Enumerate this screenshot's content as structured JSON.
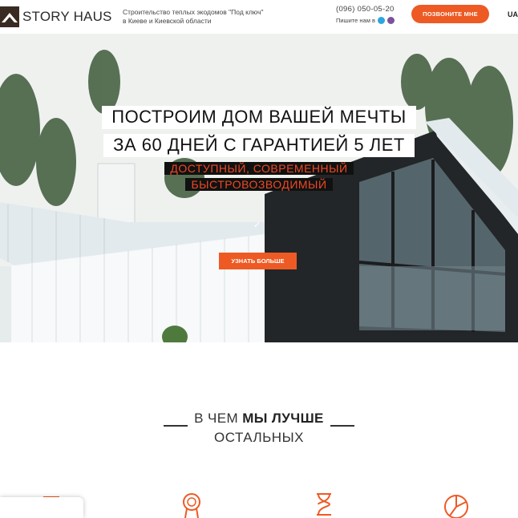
{
  "header": {
    "logo_text": "STORY HAUS",
    "tagline_line1": "Строительство теплых экодомов \"Под ключ\"",
    "tagline_line2": "в Киеве и Киевской области",
    "phone": "(096) 050-05-20",
    "write_us": "Пишите нам в",
    "call_button": "ПОЗВОНИТЕ МНЕ",
    "language": "UA",
    "accent_color": "#ee5a24"
  },
  "hero": {
    "headline_line1": "ПОСТРОИМ ДОМ ВАШЕЙ МЕЧТЫ",
    "headline_line2": "ЗА 60 ДНЕЙ С ГАРАНТИЕЙ 5 ЛЕТ",
    "sub_line1": "ДОСТУПНЫЙ, СОВРЕМЕННЫЙ",
    "sub_line2": "БЫСТРОВОЗВОДИМЫЙ",
    "more_button": "УЗНАТЬ БОЛЬШЕ"
  },
  "section": {
    "title_prefix": "В ЧЕМ",
    "title_bold": "МЫ ЛУЧШЕ",
    "title_line2": "ОСТАЛЬНЫХ"
  },
  "icons": [
    "truck-icon",
    "medal-icon",
    "hourglass-icon",
    "pie-chart-icon",
    "telegram-icon",
    "viber-icon",
    "checkmark-icon"
  ]
}
